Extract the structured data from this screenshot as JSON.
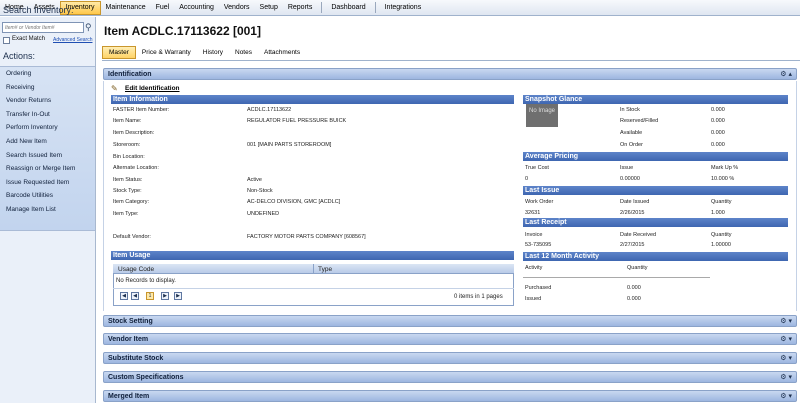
{
  "menu": {
    "items": [
      "Home",
      "Assets",
      "Inventory",
      "Maintenance",
      "Fuel",
      "Accounting",
      "Vendors",
      "Setup",
      "Reports",
      "Dashboard",
      "Integrations"
    ],
    "selected": "Inventory"
  },
  "left": {
    "search_title": "Search Inventory:",
    "search_placeholder": "Item# or Vendor Item#",
    "exact_match": "Exact Match",
    "advanced_search": "Advanced Search",
    "actions_title": "Actions:",
    "actions": [
      "Ordering",
      "Receiving",
      "Vendor Returns",
      "Transfer In-Out",
      "Perform Inventory",
      "Add New Item",
      "Search Issued Item",
      "Reassign or Merge Item",
      "Issue Requested Item",
      "Barcode Utilities",
      "Manage Item List"
    ]
  },
  "main": {
    "title": "Item ACDLC.17113622 [001]",
    "tabs": [
      "Master",
      "Price & Warranty",
      "History",
      "Notes",
      "Attachments"
    ],
    "selected_tab": "Master"
  },
  "identification": {
    "section_title": "Identification",
    "edit_link": "Edit Identification",
    "item_info_title": "Item Information",
    "fields": [
      {
        "label": "FASTER Item Number:",
        "value": "ACDLC.17113622"
      },
      {
        "label": "Item Name:",
        "value": "REGULATOR FUEL PRESSURE BUICK"
      },
      {
        "label": "Item Description:",
        "value": ""
      },
      {
        "label": "Storeroom:",
        "value": "001 [MAIN PARTS STOREROOM]"
      },
      {
        "label": "Bin Location:",
        "value": ""
      },
      {
        "label": "Alternate Location:",
        "value": ""
      },
      {
        "label": "Item Status:",
        "value": "Active"
      },
      {
        "label": "Stock Type:",
        "value": "Non-Stock"
      },
      {
        "label": "Item Category:",
        "value": "AC-DELCO DIVISION, GMC [ACDLC]"
      },
      {
        "label": "Item Type:",
        "value": "UNDEFINED"
      }
    ],
    "default_vendor_label": "Default Vendor:",
    "default_vendor_value": "FACTORY MOTOR PARTS COMPANY [608567]",
    "usage": {
      "title": "Item Usage",
      "col_code": "Usage Code",
      "col_type": "Type",
      "empty": "No Records to display.",
      "page": "1",
      "items_info": "0 items in 1 pages"
    },
    "snapshot": {
      "title": "Snapshot Glance",
      "image_text": "No Image",
      "rows": [
        {
          "label": "In Stock",
          "value": "0.000"
        },
        {
          "label": "Reserved/Filled",
          "value": "0.000"
        },
        {
          "label": "Available",
          "value": "0.000"
        },
        {
          "label": "On Order",
          "value": "0.000"
        }
      ]
    },
    "pricing": {
      "title": "Average Pricing",
      "headers": [
        "True Cost",
        "Issue",
        "Mark Up %"
      ],
      "values": [
        "0",
        "0.00000",
        "10.000 %"
      ]
    },
    "last_issue": {
      "title": "Last Issue",
      "headers": [
        "Work Order",
        "Date Issued",
        "Quantity"
      ],
      "values": [
        "32631",
        "2/26/2015",
        "1.000"
      ]
    },
    "last_receipt": {
      "title": "Last Receipt",
      "headers": [
        "Invoice",
        "Date Received",
        "Quantity"
      ],
      "values": [
        "53-735095",
        "2/27/2015",
        "1.00000"
      ]
    },
    "activity": {
      "title": "Last 12 Month Activity",
      "headers": [
        "Activity",
        "Quantity"
      ],
      "rows": [
        {
          "label": "Purchased",
          "value": "0.000"
        },
        {
          "label": "Issued",
          "value": "0.000"
        }
      ]
    }
  },
  "sections": [
    "Stock Setting",
    "Vendor Item",
    "Substitute Stock",
    "Custom Specifications",
    "Merged Item"
  ]
}
